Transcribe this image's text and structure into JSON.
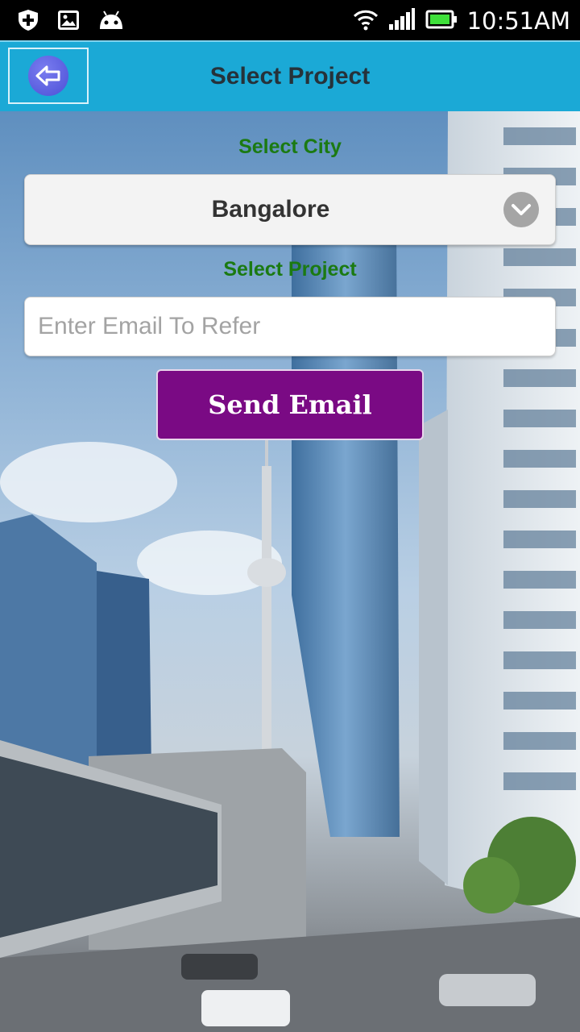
{
  "status_bar": {
    "time": "10:51AM",
    "icons": [
      "shield-plus-icon",
      "image-icon",
      "android-icon",
      "wifi-icon",
      "signal-icon",
      "battery-icon"
    ]
  },
  "app_bar": {
    "title": "Select Project",
    "back_icon": "back-arrow-icon"
  },
  "form": {
    "city_label": "Select City",
    "city_value": "Bangalore",
    "project_label": "Select Project",
    "email_placeholder": "Enter Email To Refer",
    "email_value": "",
    "send_label": "Send Email"
  },
  "colors": {
    "app_bar": "#1ba9d6",
    "label_green": "#1b7a12",
    "button_purple": "#7a0a84"
  }
}
